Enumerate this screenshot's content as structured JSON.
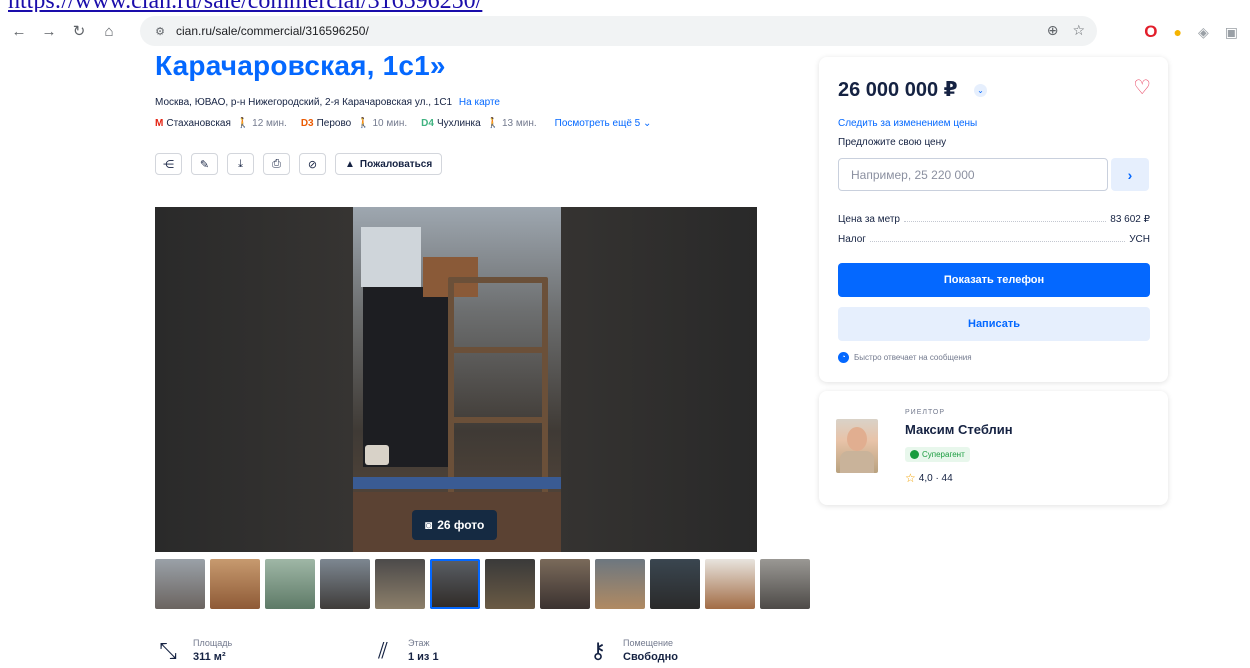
{
  "browser": {
    "top_url_text": "https://www.cian.ru/sale/commercial/316596250/",
    "address_bar_url": "cian.ru/sale/commercial/316596250/"
  },
  "listing": {
    "title": "Карачаровская, 1с1»",
    "address": "Москва, ЮВАО, р-н Нижегородский, 2-я Карачаровская ул., 1С1",
    "map_link": "На карте",
    "metro": [
      {
        "line": "М",
        "name": "Стахановская",
        "walk": "12 мин.",
        "color": "#e42313"
      },
      {
        "line": "D3",
        "name": "Перово",
        "walk": "10 мин.",
        "color": "#ea5b04"
      },
      {
        "line": "D4",
        "name": "Чухлинка",
        "walk": "13 мин.",
        "color": "#40b280"
      }
    ],
    "more_metro": "Посмотреть ещё 5",
    "complain_label": "Пожаловаться",
    "photos_count_label": "26 фото"
  },
  "facts": [
    {
      "icon": "area-icon",
      "label": "Площадь",
      "value": "311 м²"
    },
    {
      "icon": "stairs-icon",
      "label": "Этаж",
      "value": "1 из 1"
    },
    {
      "icon": "key-icon",
      "label": "Помещение",
      "value": "Свободно"
    }
  ],
  "price_card": {
    "price": "26 000 000 ₽",
    "watch_price": "Следить за изменением цены",
    "offer_label": "Предложите свою цену",
    "offer_placeholder": "Например, 25 220 000",
    "price_per_meter_label": "Цена за метр",
    "price_per_meter_value": "83 602 ₽",
    "tax_label": "Налог",
    "tax_value": "УСН",
    "show_phone": "Показать телефон",
    "write": "Написать",
    "fast_reply": "Быстро отвечает на сообщения"
  },
  "agent": {
    "role": "РИЕЛТОР",
    "name": "Максим Стеблин",
    "badge": "Суперагент",
    "rating": "4,0 · 44"
  },
  "colors": {
    "brand_blue": "#0468ff",
    "text_dark": "#152242",
    "favorite": "#e84260"
  }
}
